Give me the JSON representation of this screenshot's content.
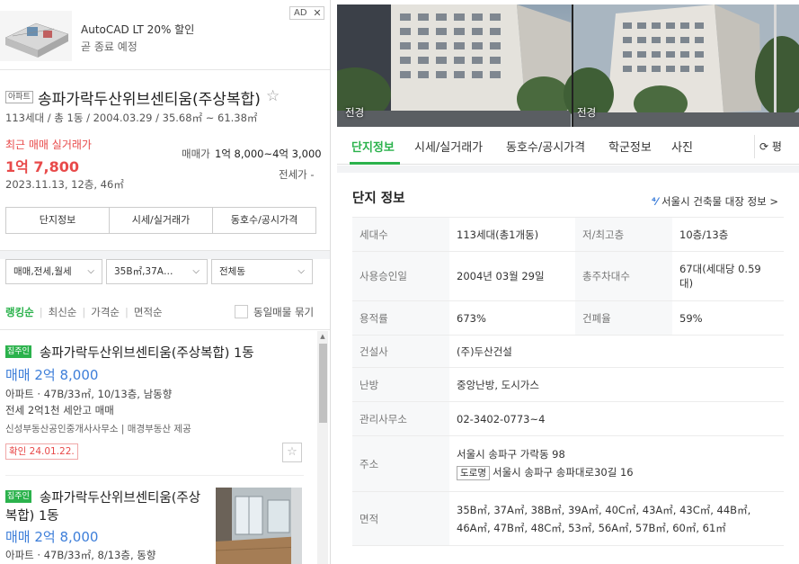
{
  "ad": {
    "title": "AutoCAD LT 20% 할인",
    "subtitle": "곧 종료 예정",
    "badge": "AD",
    "close": "✕"
  },
  "complex": {
    "type_tag": "아파트",
    "name": "송파가락두산위브센티움(주상복합)",
    "star": "☆",
    "meta": "113세대 / 총 1동 / 2004.03.29 / 35.68㎡ ~ 61.38㎡",
    "recent_label": "최근 매매 실거래가",
    "recent_price": "1억 7,800",
    "recent_date": "2023.11.13, 12층, 46㎡",
    "sale_label": "매매가",
    "sale_range": "1억 8,000~4억 3,000",
    "jeonse": "전세가 -"
  },
  "tab_buttons": [
    "단지정보",
    "시세/실거래가",
    "동호수/공시가격"
  ],
  "filters": [
    {
      "label": "매매,전세,월세"
    },
    {
      "label": "35B㎡,37A…"
    },
    {
      "label": "전체동"
    }
  ],
  "sorts": [
    "랭킹순",
    "최신순",
    "가격순",
    "면적순"
  ],
  "same_listing_label": "동일매물 묶기",
  "listings": [
    {
      "badge": "집주인",
      "title": "송파가락두산위브센티움(주상복합) 1동",
      "price": "매매 2억 8,000",
      "spec": "아파트 · 47B/33㎡, 10/13층, 남동향",
      "desc": "전세 2억1천 세안고 매매",
      "agent": "신성부동산공인중개사사무소 | 매경부동산 제공",
      "confirm": "확인 24.01.22.",
      "fav": "☆"
    },
    {
      "badge": "집주인",
      "title_line1": "송파가락두산위브센티움(주상",
      "title_line2": "복합) 1동",
      "price": "매매 2억 8,000",
      "spec": "아파트 · 47B/33㎡, 8/13층, 동향"
    }
  ],
  "photos": [
    {
      "label": "전경"
    },
    {
      "label": "전경"
    }
  ],
  "right_tabs": [
    "단지정보",
    "시세/실거래가",
    "동호수/공시가격",
    "학군정보",
    "사진"
  ],
  "refresh_label": "평",
  "info": {
    "title": "단지 정보",
    "link": "서울시 건축물 대장 정보 >",
    "rows": {
      "households_label": "세대수",
      "households": "113세대(총1개동)",
      "floors_label": "저/최고층",
      "floors": "10층/13층",
      "approval_label": "사용승인일",
      "approval": "2004년 03월 29일",
      "parking_label": "총주차대수",
      "parking": "67대(세대당 0.59 대)",
      "far_label": "용적률",
      "far": "673%",
      "bcr_label": "건폐율",
      "bcr": "59%",
      "builder_label": "건설사",
      "builder": "(주)두산건설",
      "heating_label": "난방",
      "heating": "중앙난방, 도시가스",
      "office_label": "관리사무소",
      "office": "02-3402-0773~4",
      "address_label": "주소",
      "address": "서울시 송파구 가락동 98",
      "road_tag": "도로명",
      "road_address": "서울시 송파구 송파대로30길 16",
      "area_label": "면적",
      "area_line1": "35B㎡, 37A㎡, 38B㎡, 39A㎡, 40C㎡, 43A㎡, 43C㎡, 44B㎡,",
      "area_line2": "46A㎡, 47B㎡, 48C㎡, 53㎡, 56A㎡, 57B㎡, 60㎡, 61㎡"
    }
  }
}
